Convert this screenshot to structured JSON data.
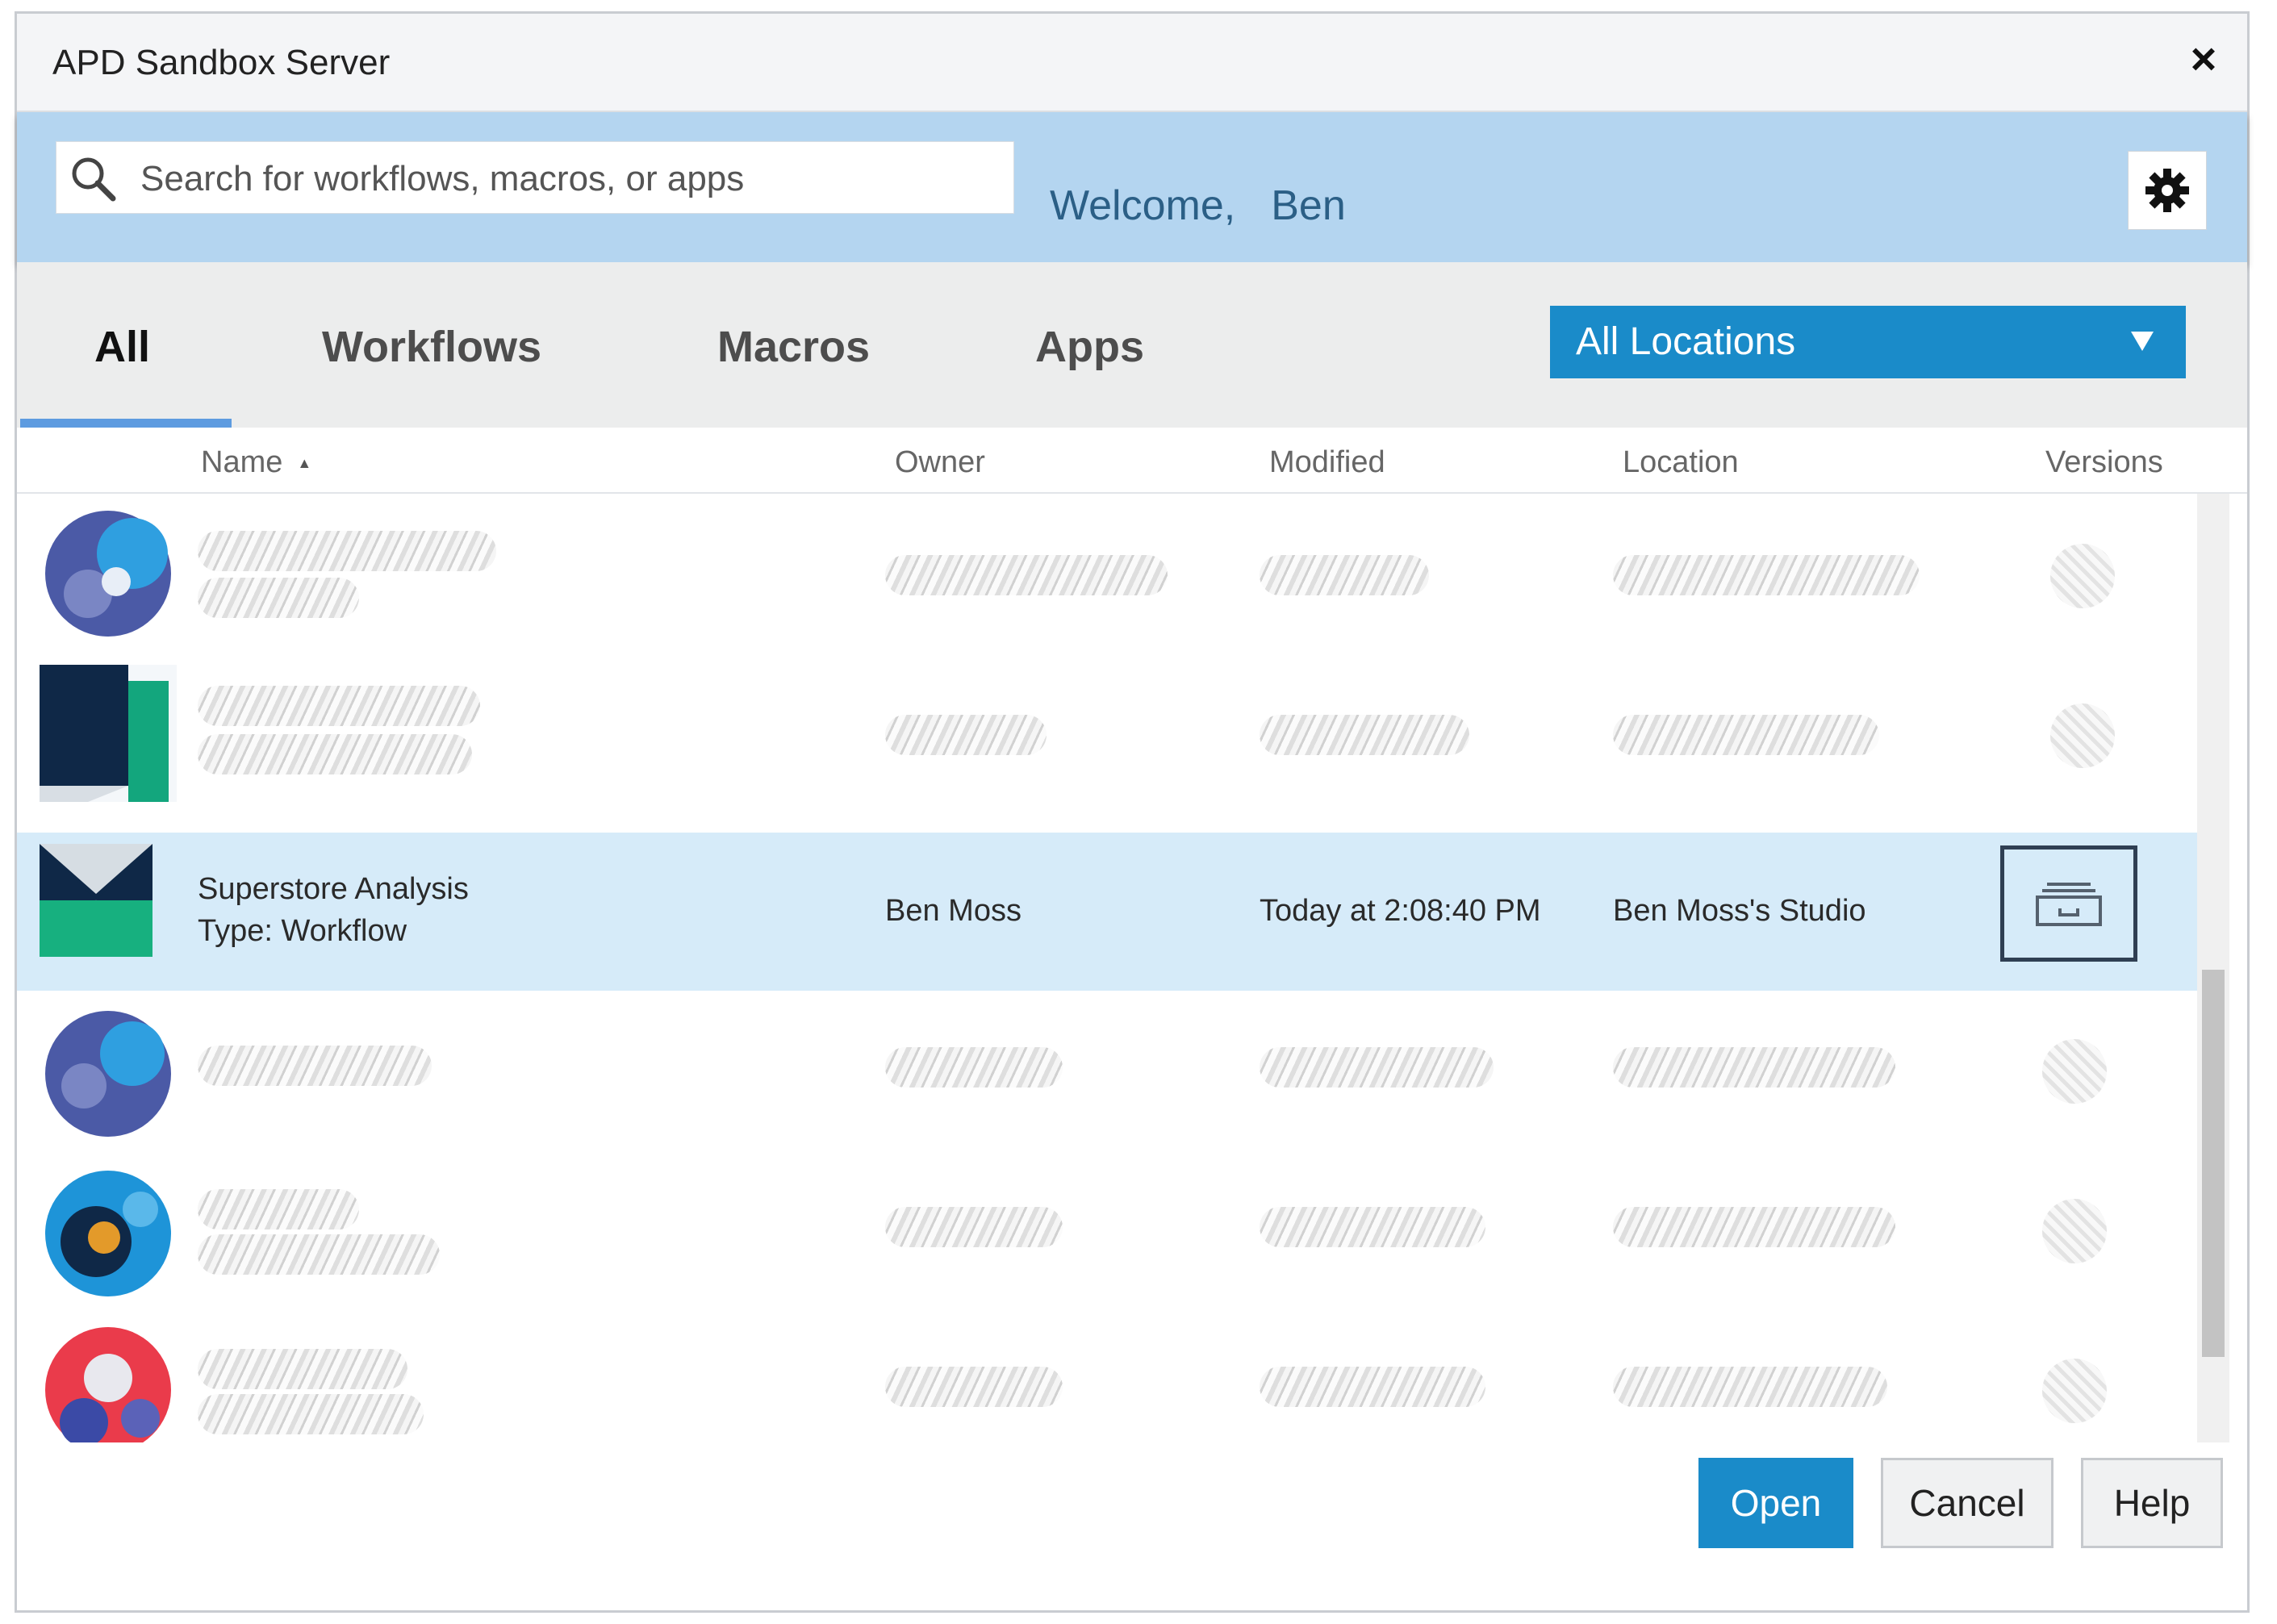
{
  "window": {
    "title": "APD Sandbox Server",
    "close_label": "×"
  },
  "header": {
    "search_placeholder": "Search for workflows, macros, or apps",
    "welcome_label": "Welcome,",
    "user_name": "Ben"
  },
  "tabs": [
    {
      "label": "All",
      "active": true
    },
    {
      "label": "Workflows",
      "active": false
    },
    {
      "label": "Macros",
      "active": false
    },
    {
      "label": "Apps",
      "active": false
    }
  ],
  "location_filter": {
    "selected": "All Locations"
  },
  "columns": {
    "name": "Name",
    "owner": "Owner",
    "modified": "Modified",
    "location": "Location",
    "versions": "Versions"
  },
  "rows": [
    {
      "obscured": true
    },
    {
      "obscured": true
    },
    {
      "obscured": false,
      "selected": true,
      "name": "Superstore Analysis",
      "type_label": "Type: Workflow",
      "owner": "Ben Moss",
      "modified": "Today at 2:08:40 PM",
      "location": "Ben Moss's Studio"
    },
    {
      "obscured": true
    },
    {
      "obscured": true
    },
    {
      "obscured": true
    }
  ],
  "buttons": {
    "open": "Open",
    "cancel": "Cancel",
    "help": "Help"
  },
  "colors": {
    "accent": "#1a8bc9",
    "header_band": "#b4d5f0",
    "selected_row": "#d6ebf9",
    "tab_underline": "#5d9be0"
  }
}
